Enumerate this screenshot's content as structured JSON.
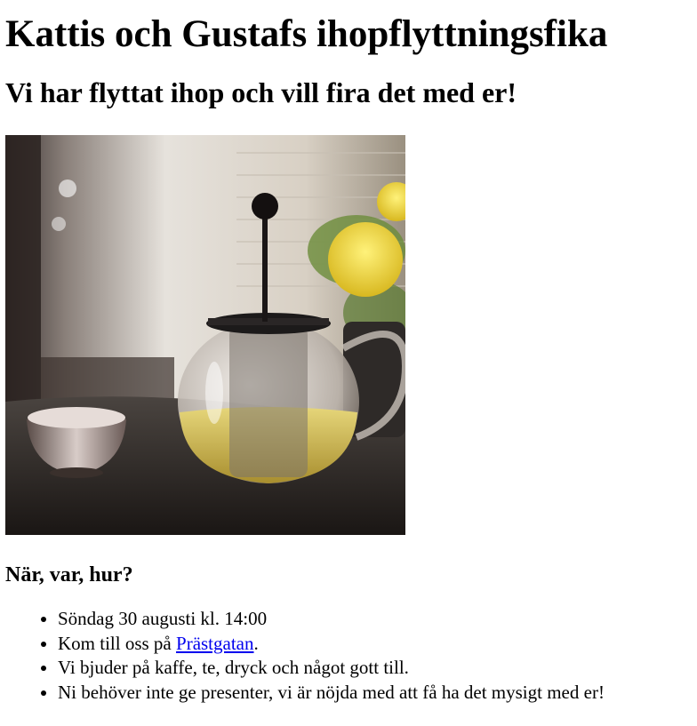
{
  "heading": "Kattis och Gustafs ihopflyttningsfika",
  "subheading": "Vi har flyttat ihop och vill fira det med er!",
  "photo": {
    "icon": "teapot-photo",
    "colors": {
      "background": "#d8d2c8",
      "table": "#2a2624",
      "tea": "#c8b450",
      "flower": "#f0dc3c",
      "leaves": "#6c8c3a"
    }
  },
  "section_title": "När, var, hur?",
  "details": {
    "item1": "Söndag 30 augusti kl. 14:00",
    "item2_prefix": "Kom till oss på ",
    "item2_link": "Prästgatan",
    "item2_suffix": ".",
    "item3": "Vi bjuder på kaffe, te, dryck och något gott till.",
    "item4": "Ni behöver inte ge presenter, vi är nöjda med att få ha det mysigt med er!"
  }
}
